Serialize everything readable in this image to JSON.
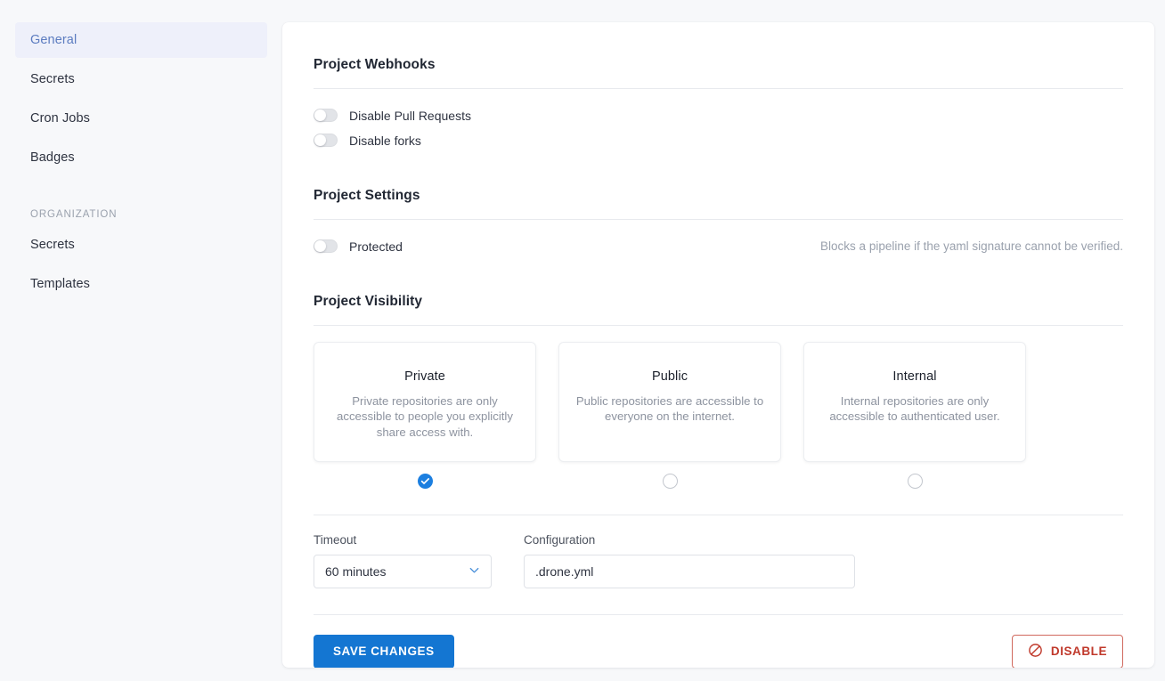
{
  "sidebar": {
    "items": [
      {
        "label": "General",
        "active": true
      },
      {
        "label": "Secrets",
        "active": false
      },
      {
        "label": "Cron Jobs",
        "active": false
      },
      {
        "label": "Badges",
        "active": false
      }
    ],
    "org_section_label": "ORGANIZATION",
    "org_items": [
      {
        "label": "Secrets",
        "active": false
      },
      {
        "label": "Templates",
        "active": false
      }
    ]
  },
  "webhooks": {
    "title": "Project Webhooks",
    "toggles": [
      {
        "label": "Disable Pull Requests",
        "on": false
      },
      {
        "label": "Disable forks",
        "on": false
      }
    ]
  },
  "project_settings": {
    "title": "Project Settings",
    "protected": {
      "label": "Protected",
      "on": false,
      "hint": "Blocks a pipeline if the yaml signature cannot be verified."
    }
  },
  "visibility": {
    "title": "Project Visibility",
    "options": [
      {
        "name": "Private",
        "description": "Private repositories are only accessible to people you explicitly share access with.",
        "selected": true
      },
      {
        "name": "Public",
        "description": "Public repositories are accessible to everyone on the internet.",
        "selected": false
      },
      {
        "name": "Internal",
        "description": "Internal repositories are only accessible to authenticated user.",
        "selected": false
      }
    ]
  },
  "fields": {
    "timeout": {
      "label": "Timeout",
      "value": "60 minutes",
      "icon": "chevron-down-icon"
    },
    "configuration": {
      "label": "Configuration",
      "value": ".drone.yml",
      "placeholder": ".drone.yml"
    }
  },
  "actions": {
    "save_label": "SAVE CHANGES",
    "disable_label": "DISABLE",
    "disable_icon": "ban-icon"
  },
  "colors": {
    "accent": "#1476d2",
    "danger": "#c0392b",
    "page_bg": "#f7f8fa",
    "active_nav_bg": "#eef0fa",
    "active_nav_text": "#5c7cc0"
  }
}
